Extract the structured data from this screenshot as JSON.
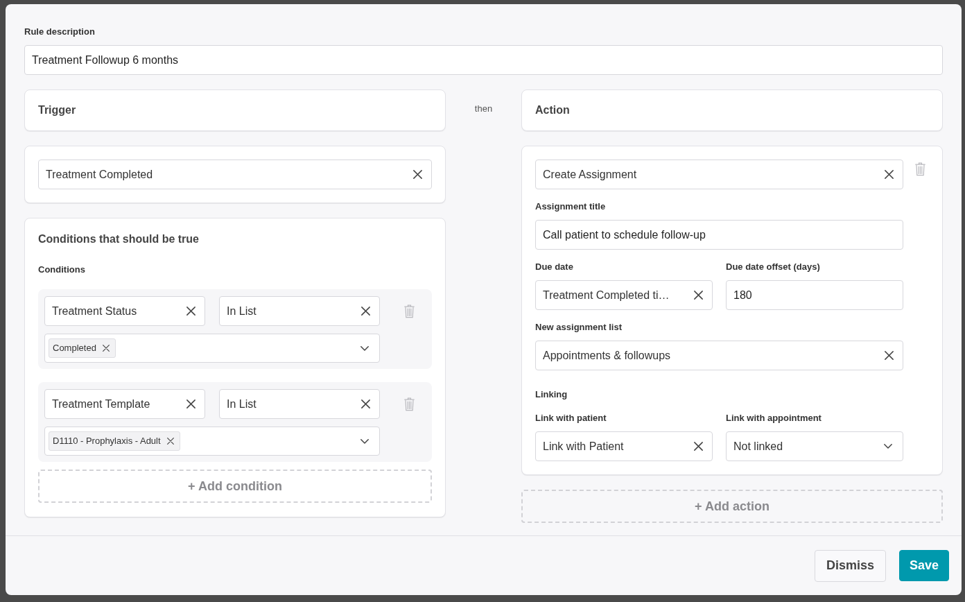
{
  "rule_description": {
    "label": "Rule description",
    "value": "Treatment Followup 6 months",
    "kind": "text"
  },
  "connector": "then",
  "trigger": {
    "title": "Trigger",
    "event": {
      "value": "Treatment Completed",
      "kind": "select"
    }
  },
  "conditions": {
    "title": "Conditions that should be true",
    "label": "Conditions",
    "items": [
      {
        "field": {
          "value": "Treatment Status",
          "kind": "select"
        },
        "operator": {
          "value": "In List",
          "kind": "select"
        },
        "values": [
          "Completed"
        ]
      },
      {
        "field": {
          "value": "Treatment Template",
          "kind": "select"
        },
        "operator": {
          "value": "In List",
          "kind": "select"
        },
        "values": [
          "D1110 - Prophylaxis - Adult"
        ]
      }
    ],
    "add_button": "+ Add condition"
  },
  "action": {
    "title": "Action",
    "items": [
      {
        "type": {
          "value": "Create Assignment",
          "kind": "select"
        },
        "rows": [
          [
            {
              "label": "Assignment title",
              "value": "Call patient to schedule follow-up",
              "kind": "text"
            }
          ],
          [
            {
              "label": "Due date",
              "value": "Treatment Completed ti…",
              "kind": "select"
            },
            {
              "label": "Due date offset (days)",
              "value": "180",
              "kind": "text"
            }
          ],
          [
            {
              "label": "New assignment list",
              "value": "Appointments & followups",
              "kind": "select"
            }
          ]
        ],
        "linking": {
          "title": "Linking",
          "rows": [
            [
              {
                "label": "Link with patient",
                "value": "Link with Patient",
                "kind": "select"
              },
              {
                "label": "Link with appointment",
                "value": "Not linked",
                "kind": "dropdown"
              }
            ]
          ]
        }
      }
    ],
    "add_button": "+ Add action"
  },
  "footer": {
    "buttons": [
      {
        "label": "Dismiss",
        "kind": "secondary"
      },
      {
        "label": "Save",
        "kind": "primary"
      }
    ]
  }
}
